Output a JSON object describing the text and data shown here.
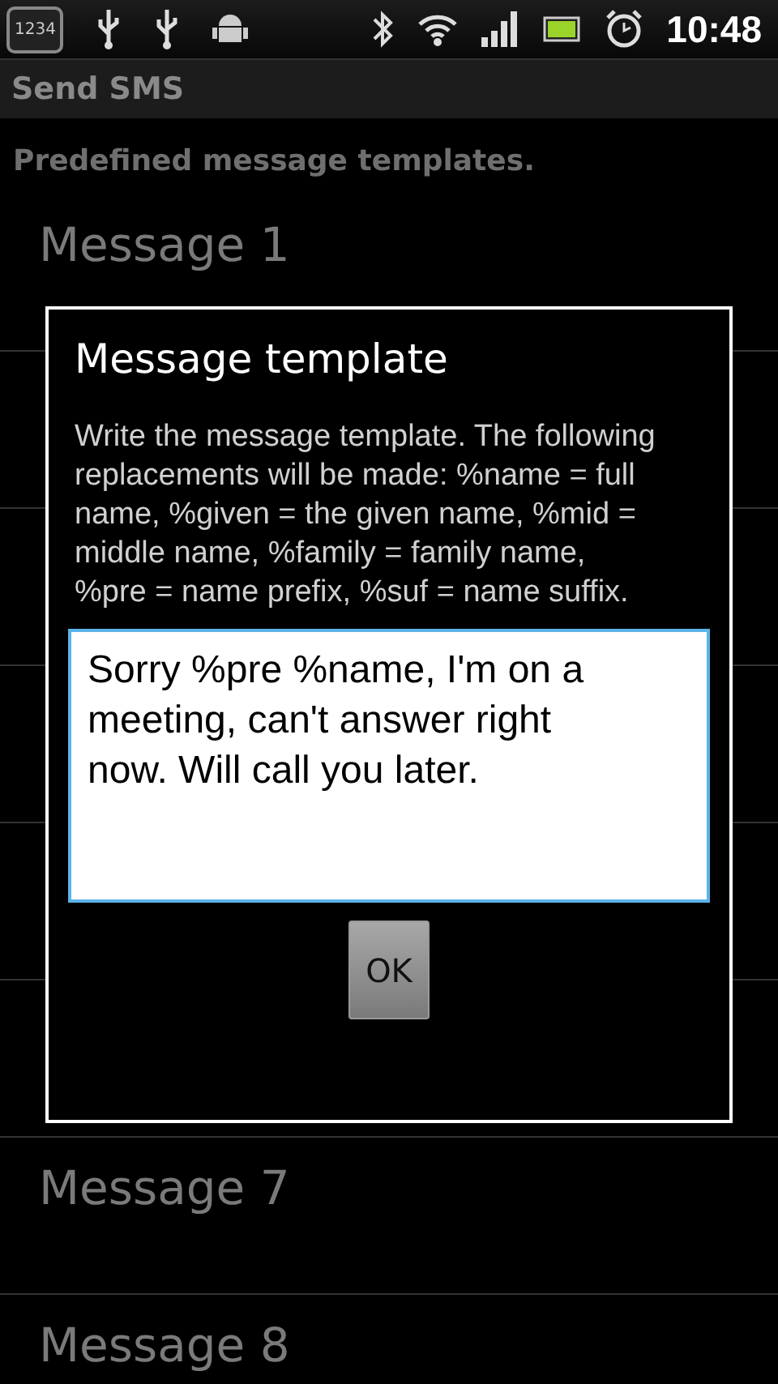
{
  "status_bar": {
    "time": "10:48",
    "badge": "1234"
  },
  "title_bar": {
    "title": "Send SMS"
  },
  "header": "Predefined message templates.",
  "messages": [
    {
      "kind": "item",
      "title": "Message 1"
    },
    {
      "kind": "covered"
    },
    {
      "kind": "covered"
    },
    {
      "kind": "covered"
    },
    {
      "kind": "covered"
    },
    {
      "kind": "covered"
    },
    {
      "kind": "item",
      "title": "Message 7"
    },
    {
      "kind": "item",
      "title": "Message 8"
    }
  ],
  "dialog": {
    "title": "Message template",
    "description": "Write the message template. The following replacements will be made: %name = full name, %given = the given name, %mid = middle name, %family = family name, %pre = name prefix, %suf = name suffix.",
    "value": "Sorry %pre %name, I'm on a meeting, can't answer right now. Will call you later.",
    "buttons": [
      "OK"
    ]
  }
}
